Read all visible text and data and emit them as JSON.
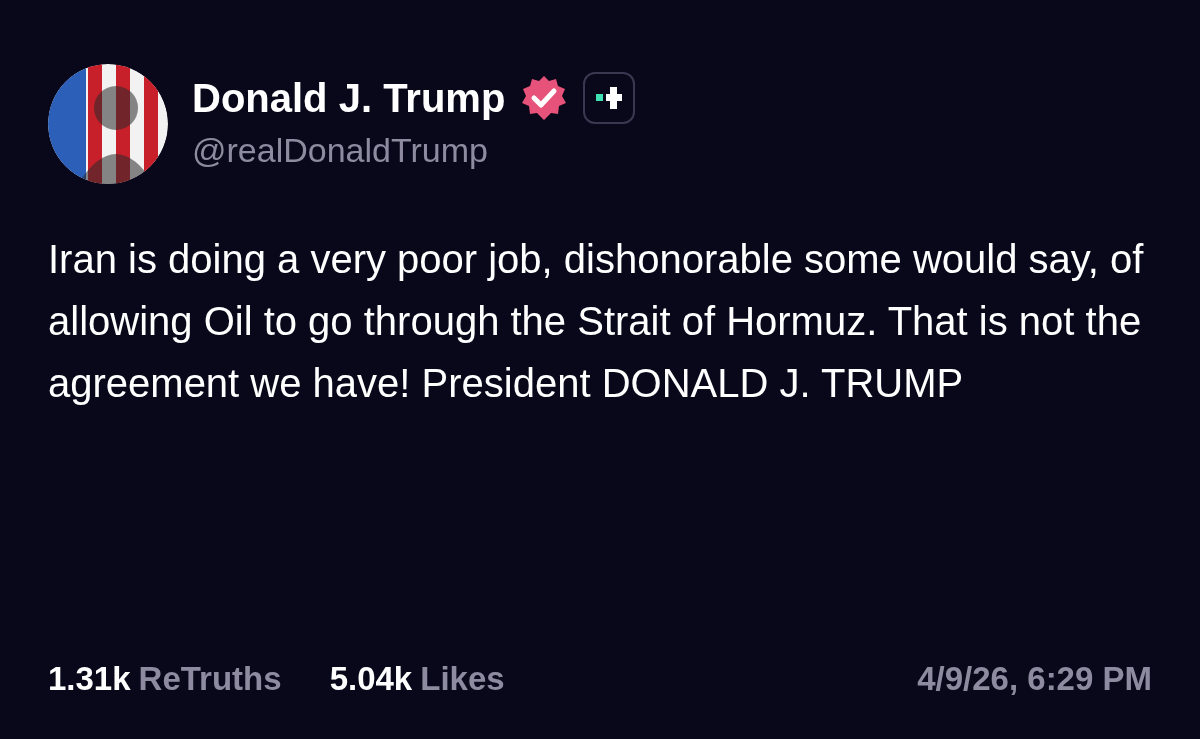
{
  "author": {
    "name": "Donald J. Trump",
    "handle": "@realDonaldTrump",
    "verified": true
  },
  "post": {
    "text": "Iran is doing a very poor job, dishonorable some would say, of allowing Oil to go through the Strait of Hormuz. That is not the agreement we have! President DONALD J. TRUMP"
  },
  "stats": [
    {
      "count": "1.31k",
      "label": "ReTruths"
    },
    {
      "count": "5.04k",
      "label": "Likes"
    }
  ],
  "timestamp": "4/9/26, 6:29 PM"
}
